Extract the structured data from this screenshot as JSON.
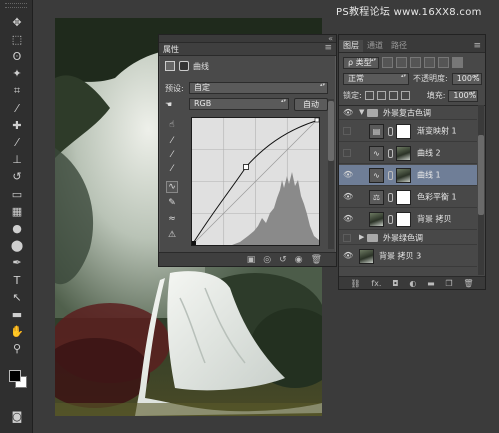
{
  "watermark": "PS教程论坛 www.16XX8.com",
  "watermark_bottom": "",
  "toolbar": {
    "tools": [
      "move-tool",
      "marquee-tool",
      "lasso-tool",
      "magic-wand-tool",
      "crop-tool",
      "eyedropper-tool",
      "healing-brush-tool",
      "brush-tool",
      "clone-stamp-tool",
      "history-brush-tool",
      "eraser-tool",
      "gradient-tool",
      "blur-tool",
      "dodge-tool",
      "pen-tool",
      "type-tool",
      "path-selection-tool",
      "shape-tool",
      "hand-tool",
      "zoom-tool"
    ],
    "tool_glyphs": [
      "✥",
      "⬚",
      "ʘ",
      "✦",
      "⌗",
      "⁄",
      "✚",
      "⁄",
      "⊥",
      "↺",
      "▭",
      "▦",
      "●",
      "⬤",
      "✒",
      "T",
      "↖",
      "▬",
      "✋",
      "⚲"
    ]
  },
  "properties": {
    "title": "属性",
    "adjustment_name": "曲线",
    "preset_label": "预设:",
    "preset_value": "自定",
    "channel_value": "RGB",
    "auto_button": "自动",
    "curve_point": [
      0.42,
      0.61
    ]
  },
  "layers_panel": {
    "tabs": [
      "图层",
      "通道",
      "路径"
    ],
    "filter_value": "ρ 类型",
    "blend_mode": "正常",
    "opacity_label": "不透明度:",
    "opacity_value": "100%",
    "lock_label": "锁定:",
    "fill_label": "填充:",
    "fill_value": "100%",
    "layers": [
      {
        "name": "外景复古色调",
        "kind": "group-open",
        "visible": true
      },
      {
        "name": "渐变映射 1",
        "kind": "gradient-map",
        "visible": false
      },
      {
        "name": "曲线 2",
        "kind": "curves",
        "visible": false
      },
      {
        "name": "曲线 1",
        "kind": "curves",
        "visible": true,
        "selected": true
      },
      {
        "name": "色彩平衡 1",
        "kind": "color-balance",
        "visible": true
      },
      {
        "name": "背景 拷贝",
        "kind": "photo",
        "visible": true
      },
      {
        "name": "外景绿色调",
        "kind": "group-closed",
        "visible": false
      },
      {
        "name": "背景 拷贝 3",
        "kind": "photo",
        "visible": true
      }
    ]
  }
}
